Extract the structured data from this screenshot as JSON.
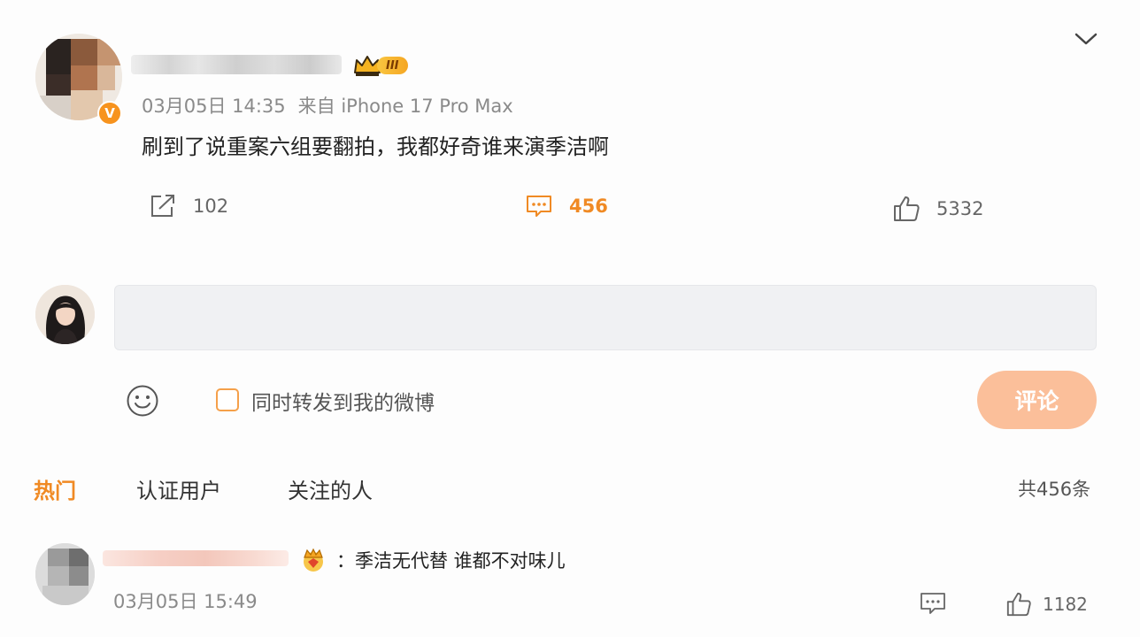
{
  "post": {
    "level_label": "III",
    "time": "03月05日 14:35",
    "source": "来自 iPhone 17 Pro Max",
    "text": "刷到了说重案六组要翻拍，我都好奇谁来演季洁啊",
    "verified_mark": "V"
  },
  "actions": {
    "repost_count": "102",
    "comment_count": "456",
    "like_count": "5332"
  },
  "composer": {
    "input_value": "",
    "checkbox_label": "同时转发到我的微博",
    "submit_label": "评论"
  },
  "tabs": [
    {
      "label": "热门",
      "active": true
    },
    {
      "label": "认证用户",
      "active": false
    },
    {
      "label": "关注的人",
      "active": false
    }
  ],
  "total_count": "共456条",
  "comments": [
    {
      "separator": "：",
      "text": "季洁无代替 谁都不对味儿",
      "time": "03月05日 15:49",
      "like_count": "1182"
    }
  ],
  "colors": {
    "accent": "#f08a24",
    "submit_bg": "#fbbf9a",
    "input_bg": "#f0f1f3"
  },
  "icons": [
    "chevron-down-icon",
    "repost-icon",
    "comment-icon",
    "thumbs-up-icon",
    "emoji-icon",
    "crown-icon"
  ]
}
